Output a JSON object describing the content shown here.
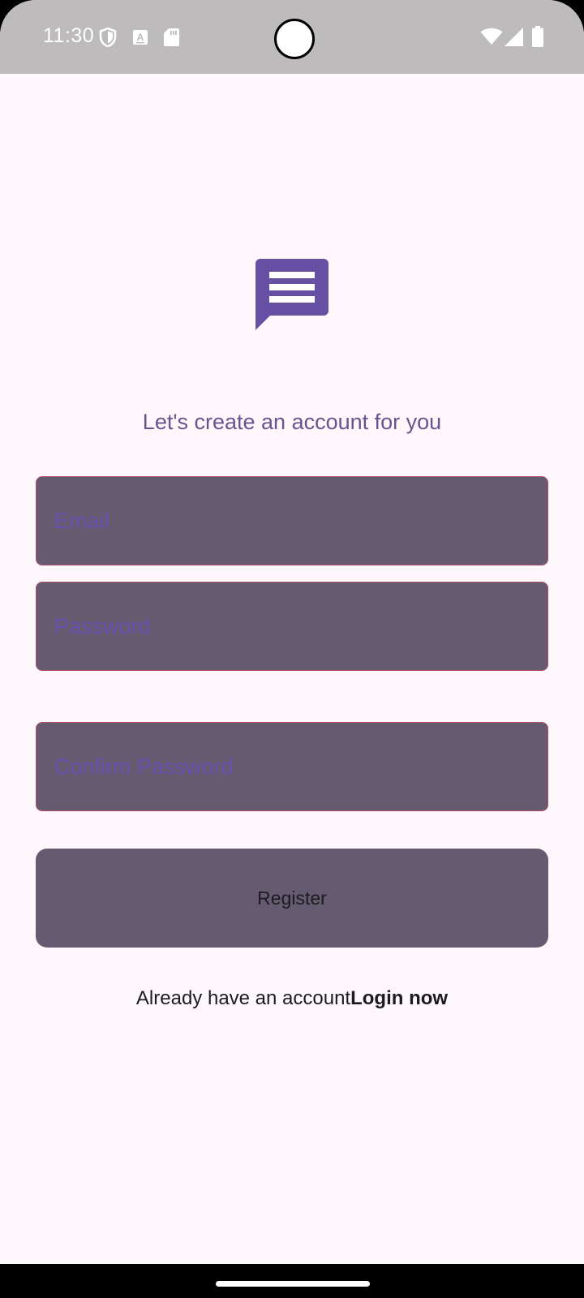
{
  "status_bar": {
    "time": "11:30",
    "left_icons": [
      "shield-icon",
      "text-a-icon",
      "sd-card-icon"
    ],
    "right_icons": [
      "wifi-icon",
      "signal-icon",
      "battery-icon"
    ],
    "background_color": "#bdbbbc"
  },
  "app": {
    "logo_icon": "message-icon",
    "subtitle": "Let's create an account for you",
    "email_field": {
      "placeholder": "Email",
      "value": ""
    },
    "password_field": {
      "placeholder": "Password",
      "value": ""
    },
    "confirm_password_field": {
      "placeholder": "Confirm Password",
      "value": ""
    },
    "register_button": {
      "label": "Register"
    },
    "login_prompt": {
      "text": "Already have an account",
      "link": "Login now"
    }
  },
  "colors": {
    "background": "#fef7fc",
    "primary": "#6750a4",
    "field_fill": "#655b71",
    "field_border": "#b04f6a",
    "placeholder": "#6a4fb0",
    "subtitle": "#65558f"
  }
}
